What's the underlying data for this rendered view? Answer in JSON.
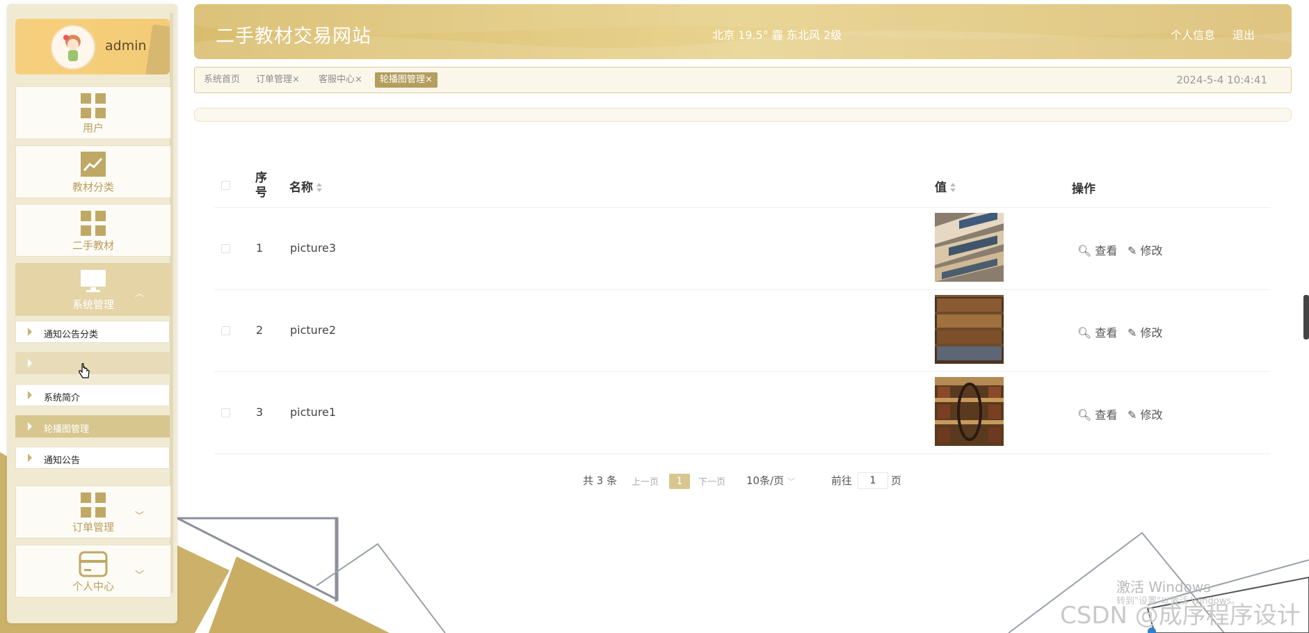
{
  "user": {
    "name": "admin"
  },
  "header": {
    "title": "二手教材交易网站",
    "weather": "北京  19.5°  霾  东北风  2级",
    "links": [
      "个人信息",
      "退出"
    ]
  },
  "sidebar": {
    "tiles": [
      {
        "label": "用户",
        "icon": "grid-icon"
      },
      {
        "label": "教材分类",
        "icon": "chart-icon"
      },
      {
        "label": "二手教材",
        "icon": "grid-icon"
      },
      {
        "label": "系统管理",
        "icon": "monitor-icon",
        "expanded": true
      },
      {
        "label": "订单管理",
        "icon": "grid-icon"
      },
      {
        "label": "个人中心",
        "icon": "card-icon"
      }
    ],
    "subitems": [
      "通知公告分类",
      "",
      "系统简介",
      "轮播图管理",
      "通知公告"
    ]
  },
  "tabs": {
    "items": [
      "系统首页",
      "订单管理",
      "客服中心",
      "轮播图管理"
    ],
    "close": "×",
    "datetime": "2024-5-4 10:4:41"
  },
  "table": {
    "headers": {
      "index": "序号",
      "name": "名称",
      "value": "值",
      "actions": "操作"
    },
    "rows": [
      {
        "index": "1",
        "name": "picture3",
        "image": "bookshelves-1"
      },
      {
        "index": "2",
        "name": "picture2",
        "image": "bookshelves-2"
      },
      {
        "index": "3",
        "name": "picture1",
        "image": "library-spiral"
      }
    ],
    "actions": {
      "view": "查看",
      "edit": "修改"
    }
  },
  "pagination": {
    "total": "共 3 条",
    "prev": "上一页",
    "current": "1",
    "next": "下一页",
    "page_size": "10条/页",
    "goto_prefix": "前往",
    "goto_value": "1",
    "goto_suffix": "页"
  },
  "overlay": {
    "activate_windows": "激活 Windows",
    "activate_hint": "转到\"设置\"以激活 Windows。",
    "csdn": "CSDN @成序程序设计"
  },
  "colors": {
    "accent": "#d9bd6e",
    "active_tab": "#b39e5e",
    "sidebar_bg": "#f1ead3"
  }
}
